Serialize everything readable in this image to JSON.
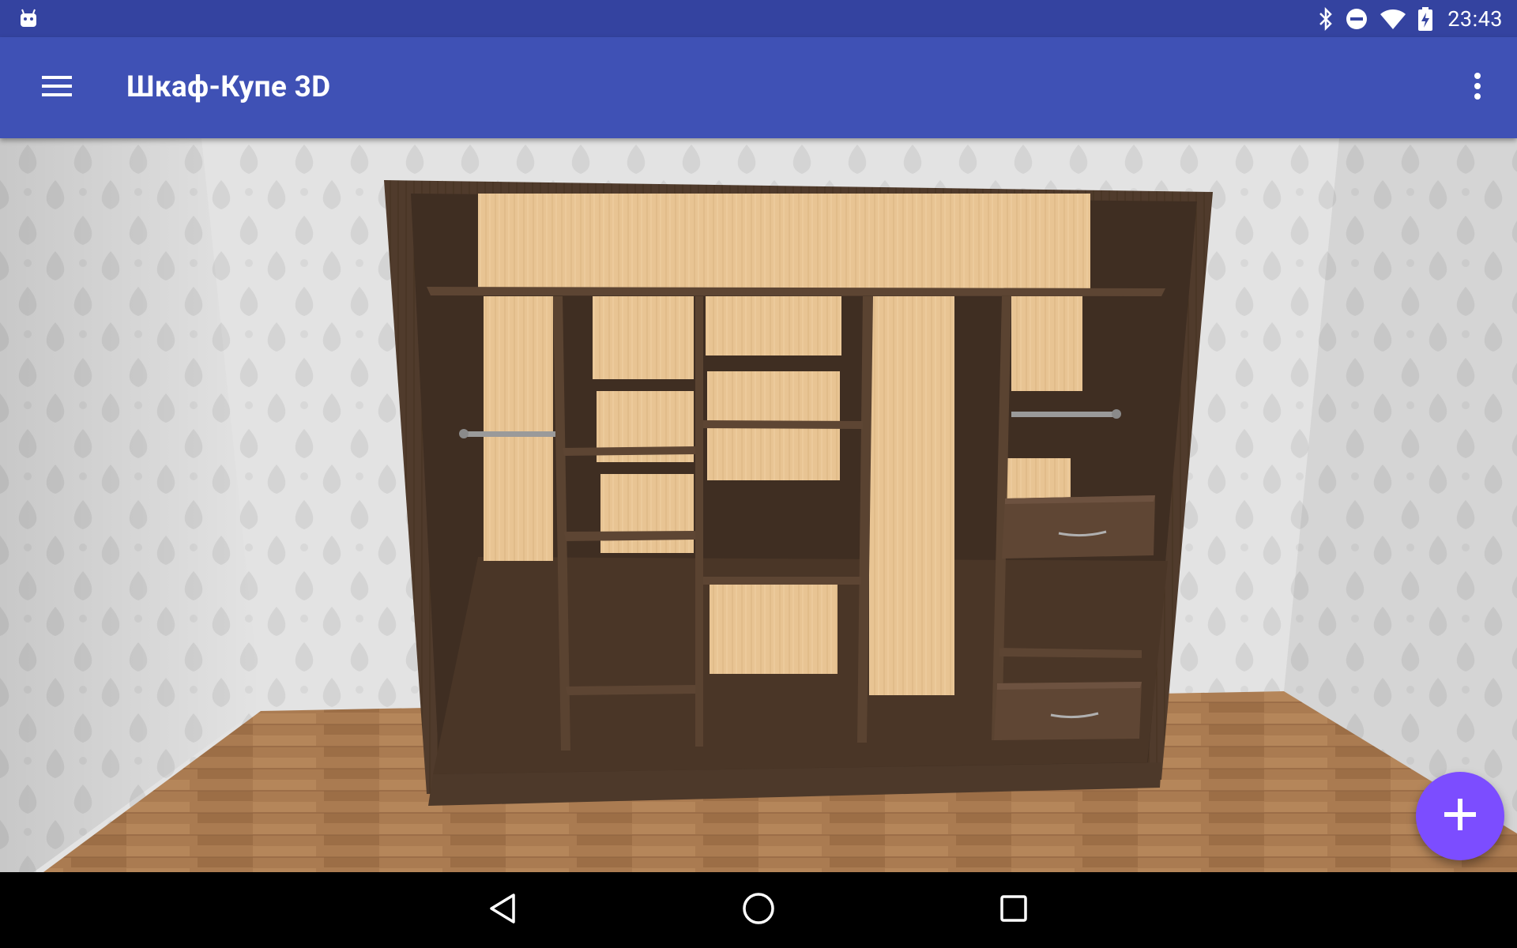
{
  "status_bar": {
    "time": "23:43",
    "icons": [
      "android-debug-icon",
      "bluetooth-icon",
      "do-not-disturb-icon",
      "wifi-icon",
      "battery-charging-icon"
    ]
  },
  "app_bar": {
    "title": "Шкаф-Купе 3D",
    "menu_icon": "hamburger-menu-icon",
    "overflow_icon": "more-vert-icon"
  },
  "scene": {
    "subject": "3d-wardrobe-model",
    "colors": {
      "wall": "#e4e4e4",
      "floor": "#a8794f",
      "wardrobe_body": "#4e3a2b",
      "back_panel": "#e9c696"
    }
  },
  "fab": {
    "icon": "plus-icon",
    "color": "#7c4dff"
  },
  "nav_bar": {
    "icons": [
      "back-icon",
      "home-icon",
      "recents-icon"
    ]
  }
}
